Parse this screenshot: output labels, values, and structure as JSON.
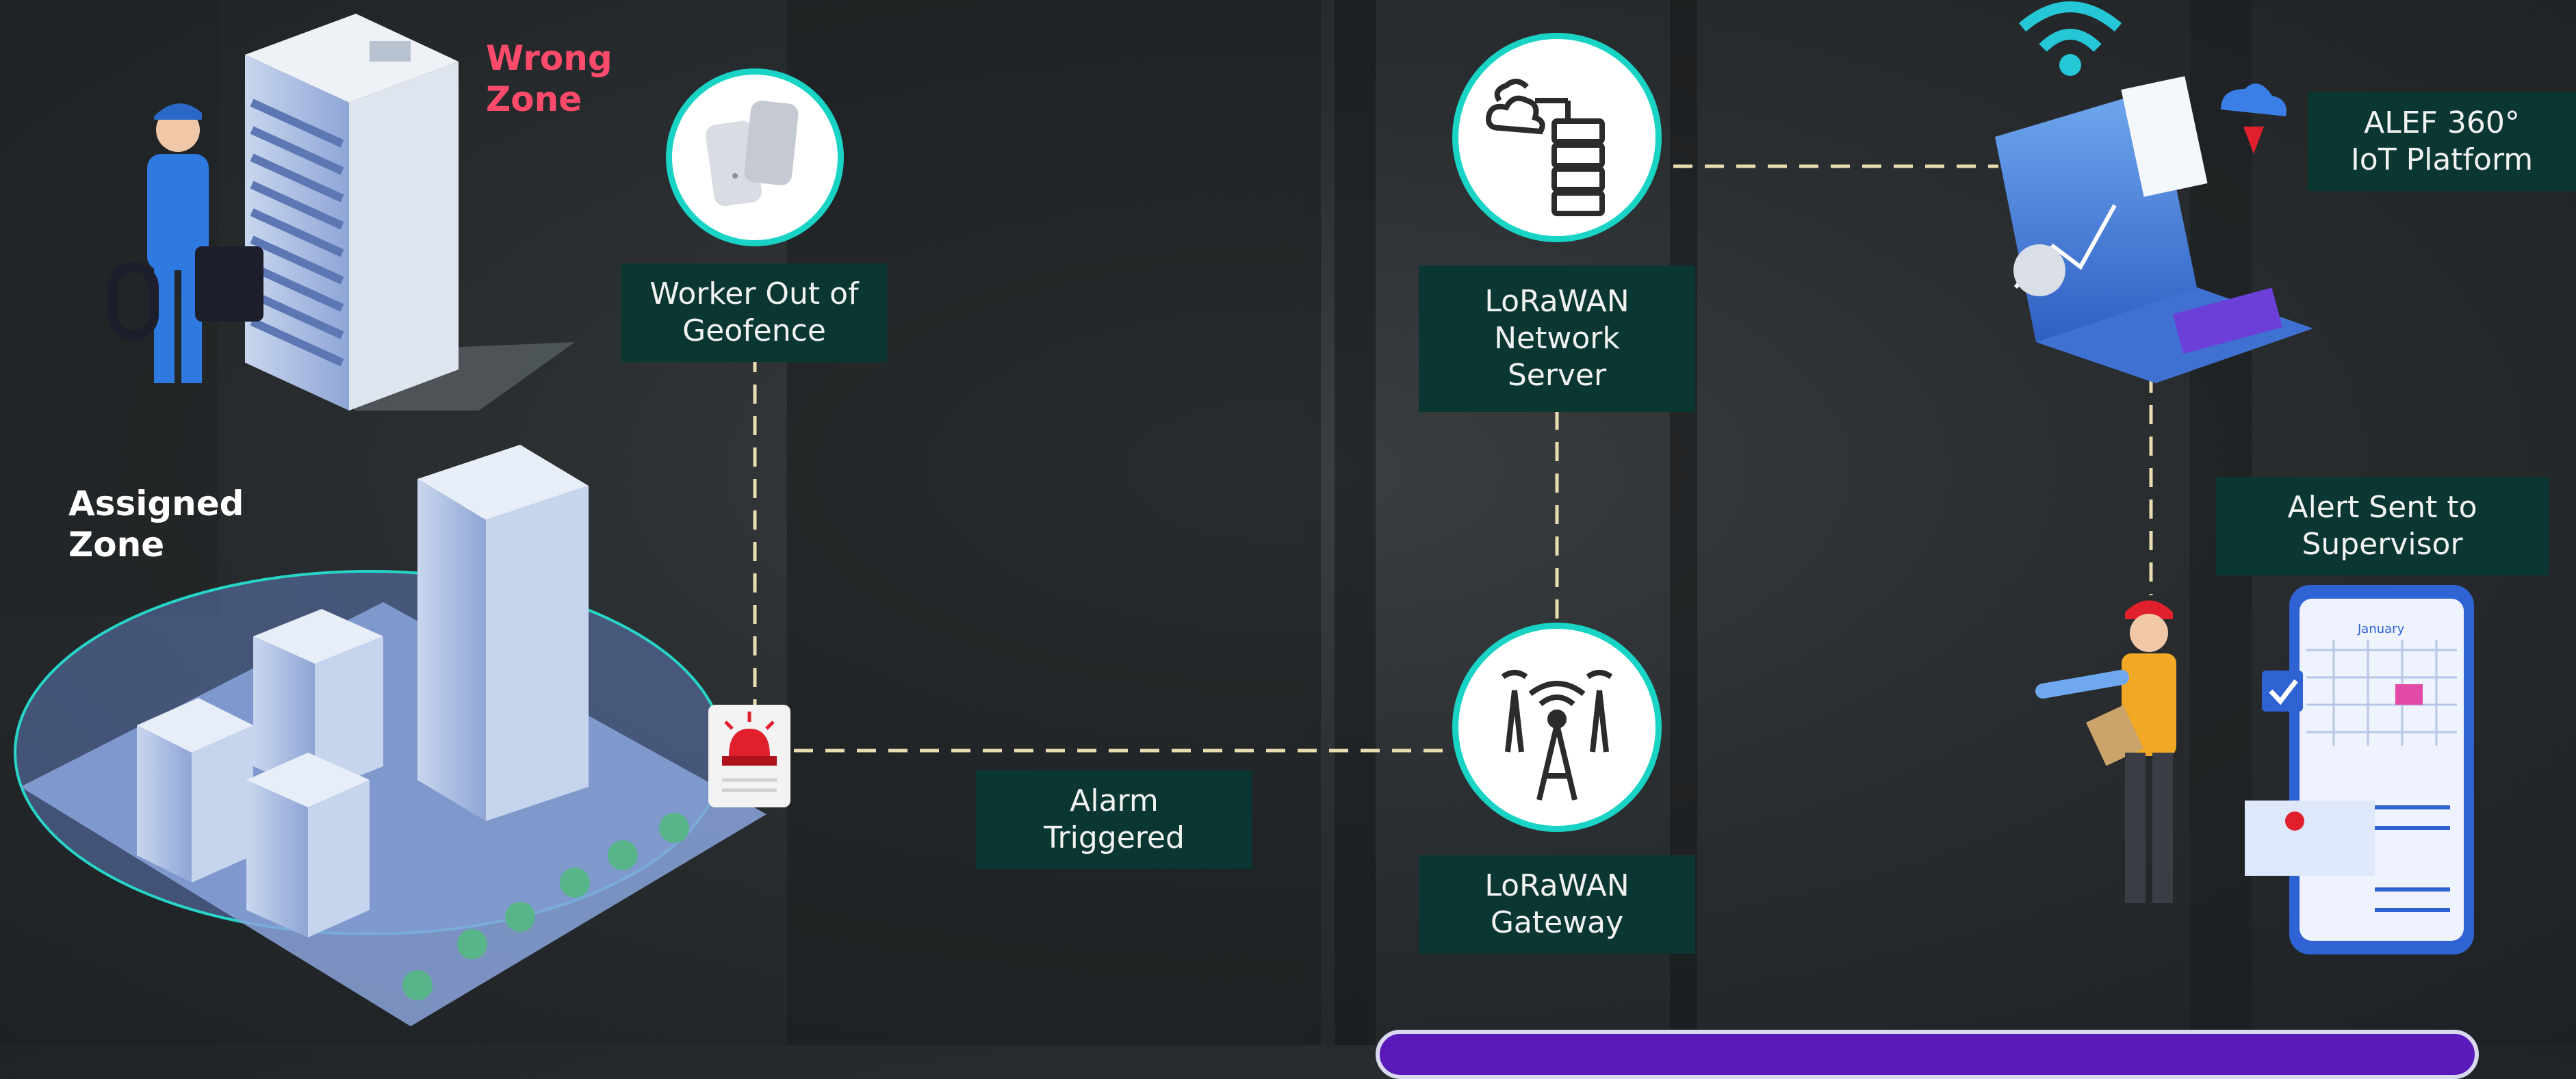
{
  "labels": {
    "wrong_zone": "Wrong\nZone",
    "assigned_zone": "Assigned\nZone",
    "worker_out": "Worker Out of\nGeofence",
    "lorawan_server": "LoRaWAN\nNetwork\nServer",
    "alef_platform": "ALEF 360°\nIoT Platform",
    "alert_sent": "Alert Sent to\nSupervisor",
    "alarm_triggered": "Alarm\nTriggered",
    "lorawan_gateway": "LoRaWAN\nGateway",
    "calendar_month": "January"
  },
  "colors": {
    "teal_box": "#0b3733",
    "teal_ring": "#19d3c5",
    "wrong_zone": "#ff4b6b",
    "dashed_line": "#e8dcb0",
    "bottom_bar": "#5a19b9"
  }
}
